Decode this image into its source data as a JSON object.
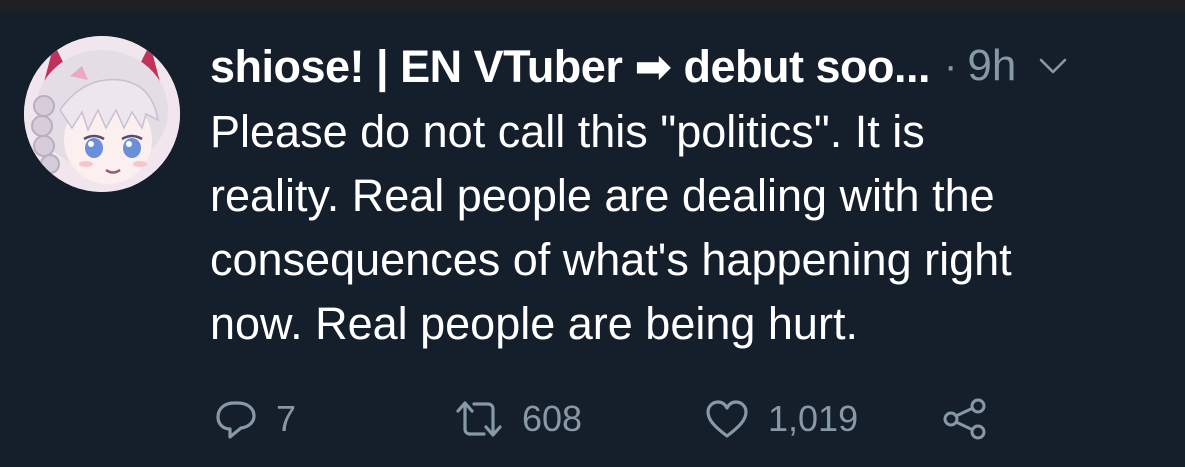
{
  "tweet": {
    "author": {
      "display_name": "shiose! | EN VTuber ➡ debut soo...",
      "avatar_icon": "anime-girl-avatar"
    },
    "separator": "·",
    "time": "9h",
    "menu_icon": "chevron-down-icon",
    "text_lines": [
      "Please do not call this \"politics\". It is",
      "reality. Real people are dealing with the",
      "consequences of what's happening right",
      "now. Real people are being hurt."
    ],
    "actions": {
      "reply": {
        "icon": "reply-icon",
        "count": "7"
      },
      "retweet": {
        "icon": "retweet-icon",
        "count": "608"
      },
      "like": {
        "icon": "heart-icon",
        "count": "1,019"
      },
      "share": {
        "icon": "share-icon"
      }
    },
    "colors": {
      "background": "#151e2b",
      "text": "#ffffff",
      "muted": "#8899a6"
    }
  }
}
